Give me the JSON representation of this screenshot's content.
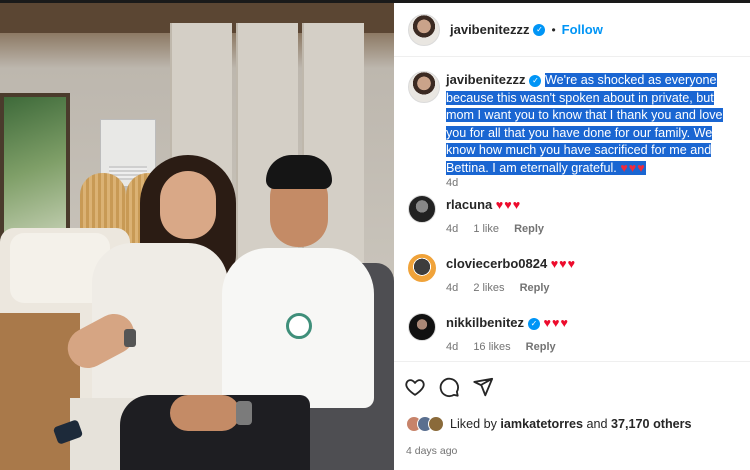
{
  "post": {
    "author": "javibenitezzz",
    "follow_label": "Follow",
    "separator": "•",
    "caption": "We're as shocked as everyone because this wasn't spoken about in private, but mom I want you to know that I thank you and love you for all that you have done for our family. We know how much you have sacrificed for me and Bettina. I am eternally grateful.",
    "caption_hearts": "♥♥♥",
    "caption_age": "4d",
    "likes_prefix": "Liked by",
    "liked_by": "iamkatetorres",
    "likes_joiner": "and",
    "likes_others": "37,170 others",
    "posted": "4 days ago"
  },
  "comments": [
    {
      "username": "rlacuna",
      "text": "♥♥♥",
      "age": "4d",
      "likes": "1 like",
      "reply": "Reply",
      "verified": false
    },
    {
      "username": "cloviecerbo0824",
      "text": "♥♥♥",
      "age": "4d",
      "likes": "2 likes",
      "reply": "Reply",
      "verified": false
    },
    {
      "username": "nikkilbenitez",
      "text": "♥♥♥",
      "age": "4d",
      "likes": "16 likes",
      "reply": "Reply",
      "verified": true
    }
  ],
  "icons": {
    "verified": "verified-badge-icon",
    "like": "heart-outline-icon",
    "comment": "comment-bubble-icon",
    "share": "paper-plane-icon"
  },
  "colors": {
    "link_blue": "#0095f6",
    "selection": "#1a66d2",
    "heart_red": "#ed0b2c",
    "muted": "#737373"
  }
}
